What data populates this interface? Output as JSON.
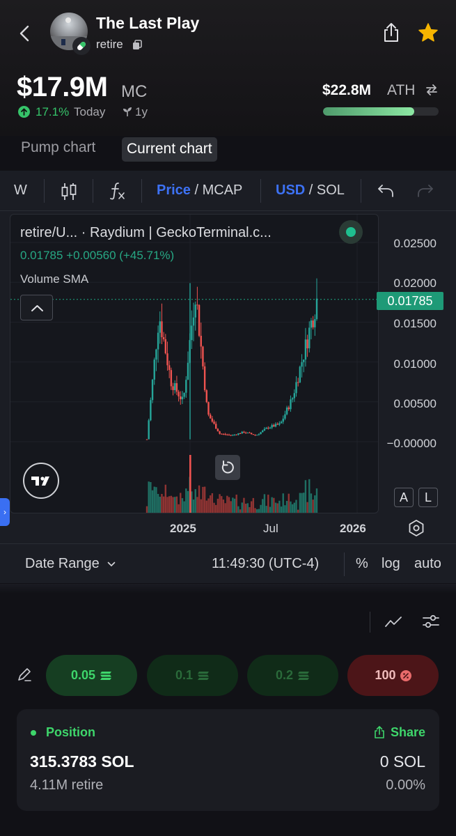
{
  "header": {
    "token_name": "The Last Play",
    "ticker": "retire",
    "market_cap": "$17.9M",
    "market_cap_unit": "MC",
    "change_pct": "17.1%",
    "change_period": "Today",
    "age": "1y",
    "ath_value": "$22.8M",
    "ath_label": "ATH",
    "ath_progress_fraction": 0.79,
    "colors": {
      "positive": "#36c46a",
      "accent_blue": "#3d72f5"
    }
  },
  "chart_tabs": {
    "pump": "Pump chart",
    "current": "Current chart",
    "selected": "Current chart"
  },
  "toolbar": {
    "interval": "W",
    "price_label": "Price",
    "mcap_label": "/ MCAP",
    "usd_label": "USD",
    "sol_label": "/ SOL"
  },
  "legend": {
    "pair": "retire/U...   · Raydium | GeckoTerminal.c...",
    "price_line": "0.01785  +0.00560 (+45.71%)",
    "volume_label": "Volume SMA"
  },
  "chart_data": {
    "type": "candlestick",
    "y_axis_ticks": [
      "0.02500",
      "0.02000",
      "0.01500",
      "0.01000",
      "0.00500",
      "−0.00000"
    ],
    "x_axis_ticks": [
      "2025",
      "Jul",
      "2026"
    ],
    "ylim": [
      0,
      0.025
    ],
    "current_price": "0.01785",
    "series": [
      {
        "name": "retire/U...",
        "points_approx": [
          {
            "t": "2024-11",
            "close": 0.0003
          },
          {
            "t": "2024-11",
            "close": 0.016
          },
          {
            "t": "2024-12",
            "close": 0.0075
          },
          {
            "t": "2024-12",
            "close": 0.005
          },
          {
            "t": "2025-01",
            "close": 0.019
          },
          {
            "t": "2025-01",
            "close": 0.0035
          },
          {
            "t": "2025-02",
            "close": 0.001
          },
          {
            "t": "2025-03",
            "close": 0.0008
          },
          {
            "t": "2025-04",
            "close": 0.0012
          },
          {
            "t": "2025-05",
            "close": 0.0008
          },
          {
            "t": "2025-06",
            "close": 0.0018
          },
          {
            "t": "2025-07",
            "close": 0.0022
          },
          {
            "t": "2025-08",
            "close": 0.0055
          },
          {
            "t": "2025-09",
            "close": 0.0115
          },
          {
            "t": "2025-10",
            "close": 0.01785
          }
        ]
      }
    ]
  },
  "chart_controls": {
    "btn_a": "A",
    "btn_l": "L",
    "date_range": "Date Range",
    "time": "11:49:30 (UTC-4)",
    "pct": "%",
    "log": "log",
    "auto": "auto"
  },
  "trade": {
    "buy_1": "0.05",
    "buy_2": "0.1",
    "buy_3": "0.2",
    "sell": "100"
  },
  "position": {
    "label": "Position",
    "share": "Share",
    "sol_amount": "315.3783 SOL",
    "token_amount": "4.11M retire",
    "value": "0 SOL",
    "pct": "0.00%"
  }
}
